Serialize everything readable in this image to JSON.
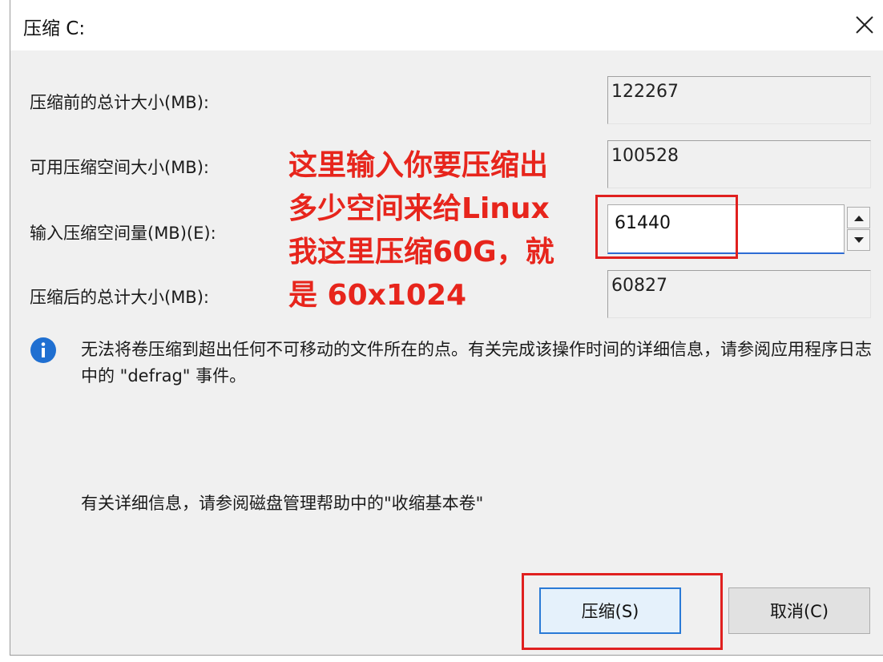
{
  "dialog": {
    "title": "压缩 C:",
    "fields": {
      "total_before": {
        "label": "压缩前的总计大小(MB):",
        "value": "122267"
      },
      "available": {
        "label": "可用压缩空间大小(MB):",
        "value": "100528"
      },
      "amount": {
        "label": "输入压缩空间量(MB)(E):",
        "value": "61440"
      },
      "total_after": {
        "label": "压缩后的总计大小(MB):",
        "value": "60827"
      }
    },
    "info_text": "无法将卷压缩到超出任何不可移动的文件所在的点。有关完成该操作时间的详细信息，请参阅应用程序日志中的 \"defrag\" 事件。",
    "help_text": "有关详细信息，请参阅磁盘管理帮助中的\"收缩基本卷\"",
    "buttons": {
      "shrink": "压缩(S)",
      "cancel": "取消(C)"
    }
  },
  "annotation": {
    "text": "这里输入你要压缩出\n多少空间来给Linux\n我这里压缩60G，就\n是 60x1024",
    "color": "#e7251c"
  },
  "colors": {
    "accent": "#2a7ad6",
    "highlight": "#e0201f",
    "info_icon": "#1f6fd1"
  }
}
